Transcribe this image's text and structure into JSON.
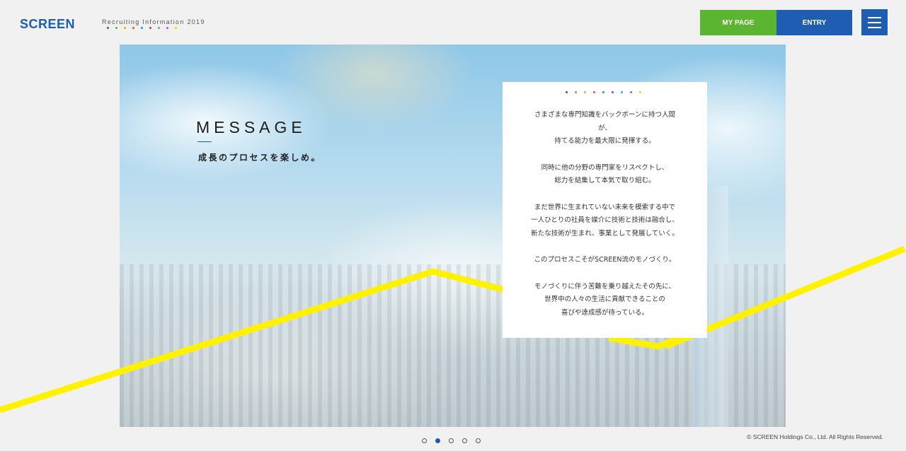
{
  "header": {
    "logo": "SCREEN",
    "tagline": "Recruiting Information 2019",
    "tagline_dot_colors": [
      "#1e5db1",
      "#5cb531",
      "#f2a900",
      "#e94b35",
      "#1e9bd7",
      "#7e47b8",
      "#3bb6a0",
      "#e94b9a",
      "#f5d300"
    ],
    "buttons": {
      "mypage": "MY PAGE",
      "entry": "ENTRY"
    },
    "menu_icon": "hamburger-icon"
  },
  "hero": {
    "title": "MESSAGE",
    "subtitle": "成長のプロセスを楽しめ。"
  },
  "message_card": {
    "dot_colors": [
      "#1e5db1",
      "#5cb531",
      "#f2a900",
      "#e94b35",
      "#1e9bd7",
      "#7e47b8",
      "#3bb6a0",
      "#e94b9a",
      "#f5d300"
    ],
    "paragraphs": [
      "さまざまな専門知識をバックボーンに持つ人間\nが、\n持てる能力を最大限に発揮する。",
      "同時に他の分野の専門家をリスペクトし、\n総力を結集して本気で取り組む。",
      "まだ世界に生まれていない未来を模索する中で\n一人ひとりの社員を媒介に技術と技術は融合し、\n新たな技術が生まれ、事業として発展していく。",
      "このプロセスこそがSCREEN流のモノづくり。",
      "モノづくりに伴う苦難を乗り越えたその先に、\n世界中の人々の生活に貢献できることの\n喜びや達成感が待っている。"
    ]
  },
  "pager": {
    "total": 5,
    "active_index": 1
  },
  "footer": {
    "copyright": "© SCREEN Holdings Co., Ltd. All Rights Reserved."
  },
  "colors": {
    "accent_line": "#fff200",
    "brand_blue": "#1e5db1",
    "brand_green": "#5cb531"
  }
}
